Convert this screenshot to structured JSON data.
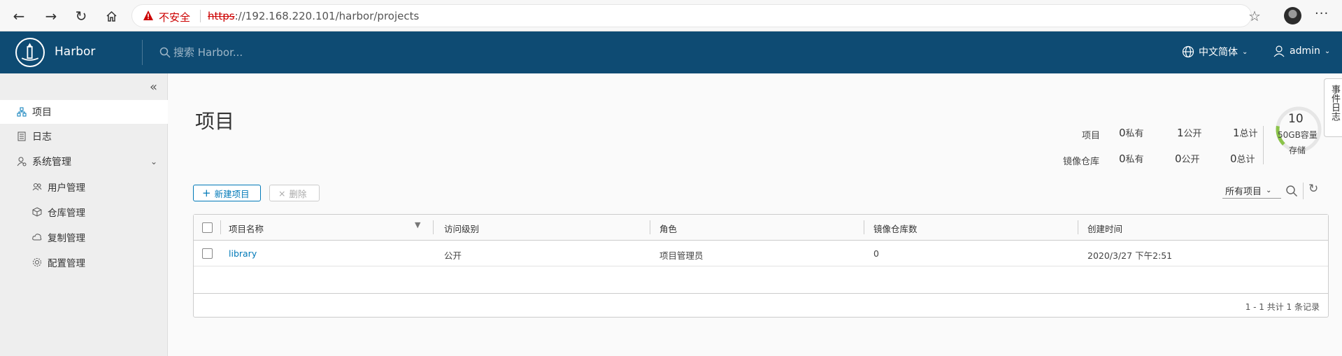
{
  "browser": {
    "insecure_label": "不安全",
    "url_scheme": "https",
    "url_rest": "://192.168.220.101/harbor/projects"
  },
  "header": {
    "brand": "Harbor",
    "search_placeholder": "搜索 Harbor...",
    "language": "中文简体",
    "user": "admin",
    "bg_color": "#0e4b73"
  },
  "sidebar": {
    "items": [
      {
        "label": "项目",
        "icon": "projects-icon",
        "active": true
      },
      {
        "label": "日志",
        "icon": "log-icon"
      },
      {
        "label": "系统管理",
        "icon": "admin-icon"
      },
      {
        "label": "用户管理",
        "icon": "users-icon"
      },
      {
        "label": "仓库管理",
        "icon": "registry-icon"
      },
      {
        "label": "复制管理",
        "icon": "replication-icon"
      },
      {
        "label": "配置管理",
        "icon": "config-icon"
      }
    ]
  },
  "main": {
    "title": "项目",
    "stats": {
      "projects_label": "项目",
      "repos_label": "镜像仓库",
      "projects": {
        "private": "0",
        "public": "1",
        "total": "1"
      },
      "repos": {
        "private": "0",
        "public": "0",
        "total": "0"
      },
      "private_unit": "私有",
      "public_unit": "公开",
      "total_unit": "总计"
    },
    "quota": {
      "value": "10",
      "capacity": "50GB容量",
      "label": "存储",
      "used_fraction": 0.2
    },
    "new_project_button": "新建项目",
    "delete_button": "删除",
    "filter": "所有项目",
    "columns": [
      "项目名称",
      "访问级别",
      "角色",
      "镜像仓库数",
      "创建时间"
    ],
    "rows": [
      {
        "name": "library",
        "access": "公开",
        "role": "项目管理员",
        "repo_count": "0",
        "created": "2020/3/27 下午2:51"
      }
    ],
    "footer": "1 - 1 共计 1 条记录"
  },
  "side_tab": "事件日志"
}
